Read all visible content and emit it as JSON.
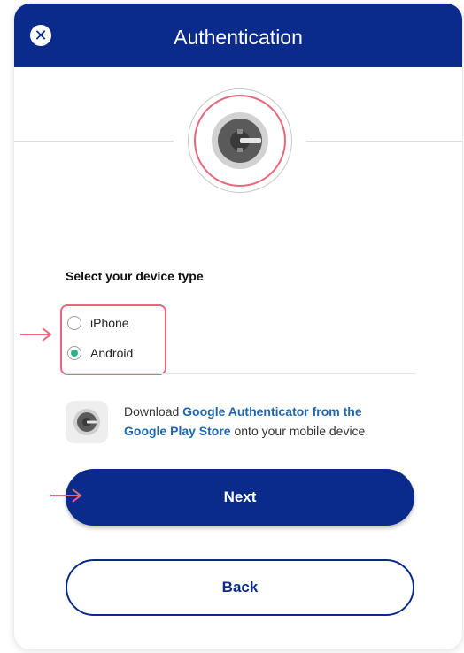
{
  "header": {
    "title": "Authentication",
    "close_icon": "close-circle-icon",
    "background": "#0a2a8c"
  },
  "device_type": {
    "label": "Select your device type",
    "options": [
      {
        "label": "iPhone",
        "selected": false
      },
      {
        "label": "Android",
        "selected": true
      }
    ],
    "selected_color": "#2bb38a"
  },
  "download": {
    "prefix": "Download ",
    "link1": "Google Authenticator from the",
    "link2": "Google Play Store",
    "suffix": " onto your mobile device.",
    "link_color": "#1e66b0"
  },
  "buttons": {
    "next": "Next",
    "back": "Back"
  },
  "annotation_color": "#e8677c"
}
